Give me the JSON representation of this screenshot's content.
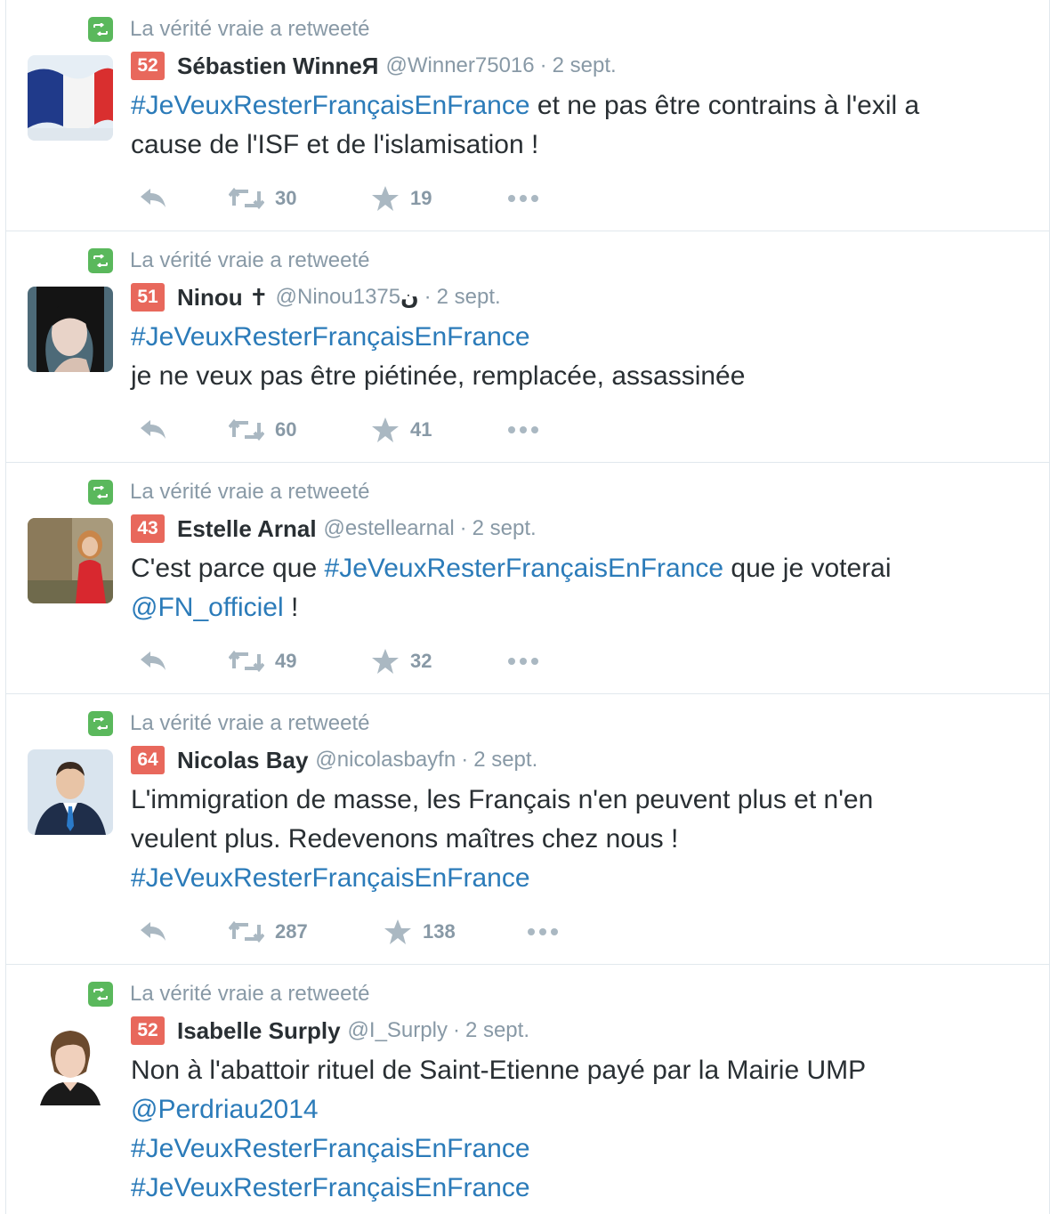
{
  "retweet_label": "La vérité vraie a retweeté",
  "colors": {
    "link": "#2b7bb9",
    "muted": "#8899a6",
    "klout_badge": "#e8685c",
    "retweet_badge": "#5ab85c",
    "text": "#292f33"
  },
  "tweets": [
    {
      "klout": "52",
      "fullname": "Sébastien WinneЯ",
      "username": "@Winner75016",
      "separator": "·",
      "time": "2 sept.",
      "lines": [
        {
          "link": "#JeVeuxResterFrançaisEnFrance",
          "text": " et ne pas être contrains à l'exil a"
        },
        {
          "text": "cause de l'ISF et de l'islamisation !"
        }
      ],
      "retweets": "30",
      "likes": "19",
      "avatar": "french-flag"
    },
    {
      "klout": "51",
      "fullname": "Ninou ✝",
      "username": "@Ninou1375",
      "username_suffix": " ن",
      "separator": "·",
      "time": "2 sept.",
      "lines": [
        {
          "link": "#JeVeuxResterFrançaisEnFrance"
        },
        {
          "text": "je ne veux pas être piétinée, remplacée, assassinée"
        }
      ],
      "retweets": "60",
      "likes": "41",
      "avatar": "woman-dark-hair"
    },
    {
      "klout": "43",
      "fullname": "Estelle Arnal",
      "username": "@estellearnal",
      "separator": "·",
      "time": "2 sept.",
      "lines": [
        {
          "text": "C'est parce que ",
          "link": "#JeVeuxResterFrançaisEnFrance",
          "text_after": " que je voterai"
        },
        {
          "link": "@FN_officiel",
          "text": " !"
        }
      ],
      "retweets": "49",
      "likes": "32",
      "avatar": "woman-red-coat"
    },
    {
      "klout": "64",
      "fullname": "Nicolas Bay",
      "username": "@nicolasbayfn",
      "separator": "·",
      "time": "2 sept.",
      "lines": [
        {
          "text": "L'immigration de masse, les Français n'en peuvent plus et n'en"
        },
        {
          "text": "veulent plus. Redevenons maîtres chez nous !"
        },
        {
          "link": "#JeVeuxResterFrançaisEnFrance"
        }
      ],
      "retweets": "287",
      "likes": "138",
      "avatar": "man-suit"
    },
    {
      "klout": "52",
      "fullname": "Isabelle Surply",
      "username": "@I_Surply",
      "separator": "·",
      "time": "2 sept.",
      "lines": [
        {
          "text": "Non à l'abattoir rituel de Saint-Etienne payé par la Mairie UMP"
        },
        {
          "link": "@Perdriau2014"
        },
        {
          "link": "#JeVeuxResterFrançaisEnFrance"
        },
        {
          "link": "#JeVeuxResterFrançaisEnFrance"
        }
      ],
      "avatar": "woman-portrait"
    }
  ]
}
